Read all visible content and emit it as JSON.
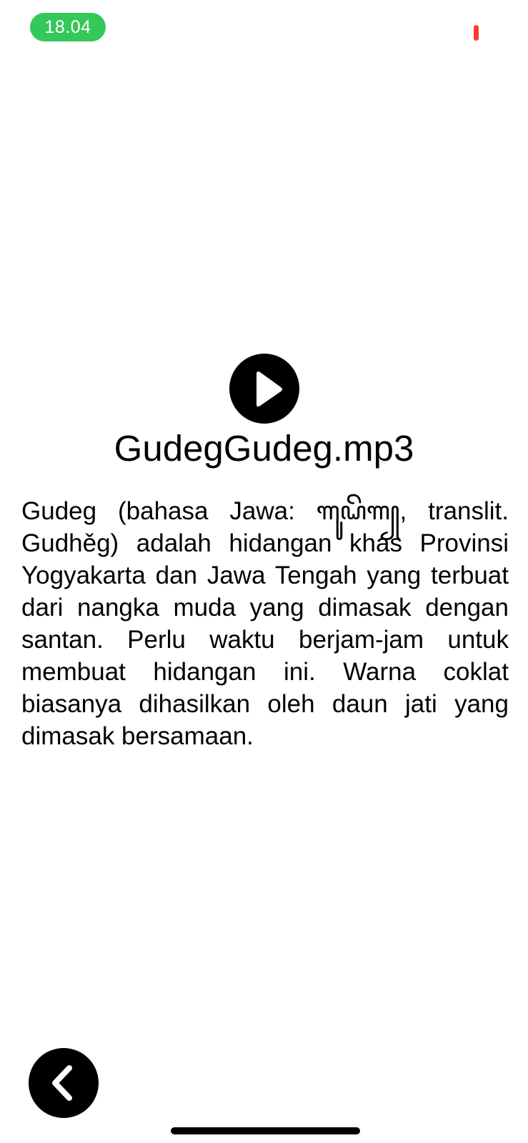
{
  "status_bar": {
    "time": "18.04",
    "status_color": "#34c759",
    "recording_indicator_color": "#ff3b30"
  },
  "player": {
    "play_icon": "play-icon",
    "file_name": "GudegGudeg.mp3"
  },
  "article": {
    "text": "Gudeg (bahasa Jawa: ꦒꦸꦝꦼꦒ꧀, translit. Gudhěg) adalah hidangan khas Provinsi Yogyakarta dan Jawa Tengah yang terbuat dari nangka muda yang dimasak dengan santan. Perlu waktu berjam-jam untuk membuat hidangan ini. Warna coklat biasanya dihasilkan oleh daun jati yang dimasak bersamaan."
  },
  "navigation": {
    "back_icon": "chevron-left-icon"
  }
}
